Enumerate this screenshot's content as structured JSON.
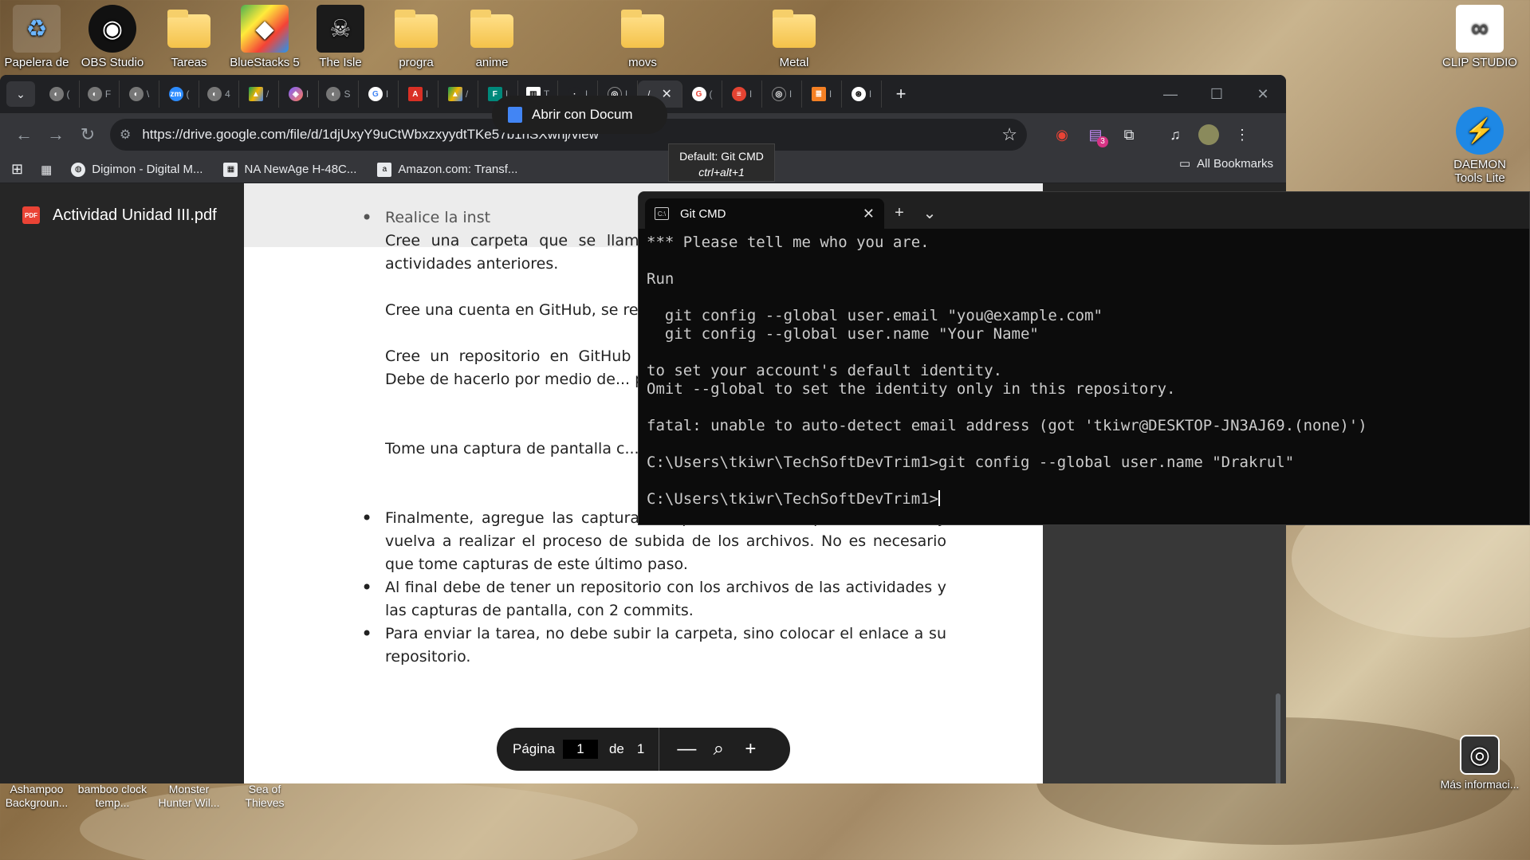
{
  "desktop": {
    "icons": [
      {
        "label": "Papelera de",
        "glyph": "♻"
      },
      {
        "label": "OBS Studio",
        "glyph": "◉"
      },
      {
        "label": "Tareas",
        "glyph": ""
      },
      {
        "label": "BlueStacks 5",
        "glyph": "◆"
      },
      {
        "label": "The Isle",
        "glyph": "☠"
      },
      {
        "label": "progra",
        "glyph": ""
      },
      {
        "label": "anime",
        "glyph": ""
      },
      {
        "label": "movs",
        "glyph": ""
      },
      {
        "label": "Metal",
        "glyph": ""
      },
      {
        "label": "CLIP STUDIO",
        "glyph": "∞"
      },
      {
        "label": "DAEMON Tools Lite",
        "glyph": "⚡"
      }
    ],
    "bottom_icons": [
      {
        "label": "Ashampoo Backgroun..."
      },
      {
        "label": "bamboo clock temp..."
      },
      {
        "label": "Monster Hunter Wil..."
      },
      {
        "label": "Sea of Thieves"
      },
      {
        "label": "Más informaci..."
      }
    ]
  },
  "browser": {
    "tabs_count": 22,
    "active_tab_index": 13,
    "url": "https://drive.google.com/file/d/1djUxyY9uCtWbxzxyydtTKe57b1nSXwnj/view",
    "bookmarks": [
      {
        "label": "Digimon - Digital M..."
      },
      {
        "label": "NA NewAge H-48C..."
      },
      {
        "label": "Amazon.com: Transf..."
      }
    ],
    "all_bookmarks": "All Bookmarks",
    "extension_badge": "3"
  },
  "viewer": {
    "file_name": "Actividad Unidad III.pdf",
    "open_with": "Abrir con Docum",
    "doc_items": [
      "Realice la inst",
      "Cree una carpeta que se llame... coloque todos los archivos que... actividades anteriores.",
      "Cree una cuenta en GitHub, se re... la universidad para este paso.",
      "Cree un repositorio en GitHub y... anteriormente.  Asegúrese de qu... Debe de hacerlo por medio de... página web de GitHub o la aplic...",
      "Tome una captura de pantalla c... el proceso para subir la carpeta... push.",
      "Finalmente, agregue las capturas de pantalla a la carpeta de tareas y vuelva a realizar el proceso de subida de los archivos. No es necesario que tome capturas de este último paso.",
      "Al final debe de tener un repositorio con los archivos de las actividades y las capturas de pantalla, con 2 commits.",
      "Para enviar la tarea, no debe subir la carpeta, sino colocar el enlace a su repositorio."
    ],
    "pager": {
      "label": "Página",
      "current": "1",
      "of": "de",
      "total": "1"
    }
  },
  "tooltip": {
    "title": "Default: Git CMD",
    "shortcut": "ctrl+alt+1"
  },
  "terminal": {
    "tab_title": "Git CMD",
    "lines": [
      "*** Please tell me who you are.",
      "",
      "Run",
      "",
      "  git config --global user.email \"you@example.com\"",
      "  git config --global user.name \"Your Name\"",
      "",
      "to set your account's default identity.",
      "Omit --global to set the identity only in this repository.",
      "",
      "fatal: unable to auto-detect email address (got 'tkiwr@DESKTOP-JN3AJ69.(none)')",
      "",
      "C:\\Users\\tkiwr\\TechSoftDevTrim1>git config --global user.name \"Drakrul\"",
      "",
      "C:\\Users\\tkiwr\\TechSoftDevTrim1>"
    ]
  },
  "colors": {
    "accent": "#1a73e8",
    "terminal_bg": "#0c0c0c",
    "chrome_dark": "#202124"
  }
}
